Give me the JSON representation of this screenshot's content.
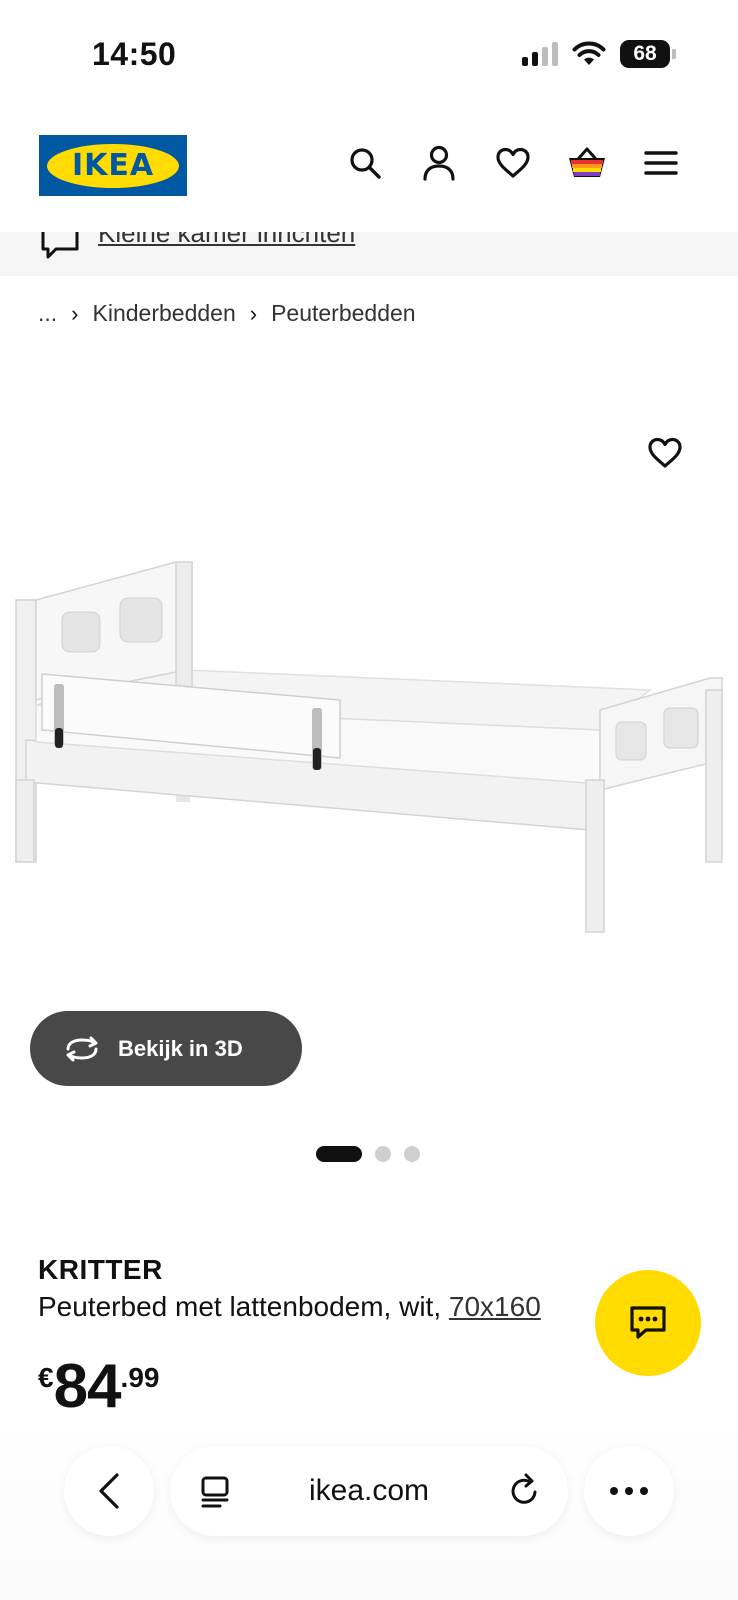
{
  "status_bar": {
    "time": "14:50",
    "battery": "68"
  },
  "header": {
    "logo_text": "IKEA",
    "icons": [
      "search-icon",
      "account-icon",
      "heart-icon",
      "basket-icon",
      "menu-icon"
    ]
  },
  "promo": {
    "link_text": "Kleine kamer inrichten"
  },
  "breadcrumb": {
    "ellipsis": "...",
    "items": [
      {
        "label": "Kinderbedden"
      },
      {
        "label": "Peuterbedden"
      }
    ]
  },
  "gallery": {
    "view_3d_label": "Bekijk in 3D",
    "dots": 3,
    "active_dot": 0
  },
  "product": {
    "name": "KRITTER",
    "description": "Peuterbed met lattenbodem, wit, ",
    "size_link": "70x160",
    "price_currency": "€",
    "price_int": "84",
    "price_dec": ".99"
  },
  "browser": {
    "url": "ikea.com"
  },
  "colors": {
    "ikea_blue": "#0058a3",
    "ikea_yellow": "#ffdb00",
    "button_dark": "#484848"
  }
}
